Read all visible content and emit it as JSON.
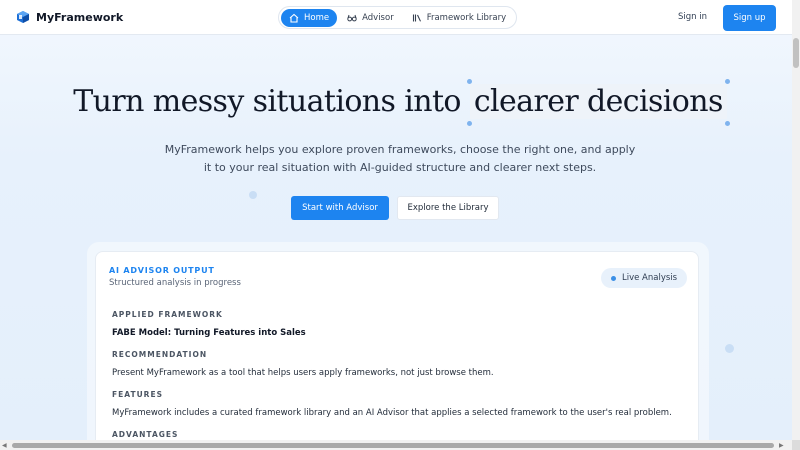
{
  "brand": {
    "name": "MyFramework",
    "logo_icon": "cube-logo-icon",
    "accent": "#1d84f0"
  },
  "nav": {
    "items": [
      {
        "label": "Home",
        "icon": "home-icon",
        "active": true
      },
      {
        "label": "Advisor",
        "icon": "glasses-icon",
        "active": false
      },
      {
        "label": "Framework Library",
        "icon": "library-icon",
        "active": false
      }
    ]
  },
  "auth": {
    "signin_label": "Sign in",
    "signup_label": "Sign up"
  },
  "hero": {
    "title_plain": "Turn messy situations into",
    "title_highlight": "clearer decisions",
    "subtitle_line1": "MyFramework helps you explore proven frameworks, choose the right one, and apply",
    "subtitle_line2": "it to your real situation with AI-guided structure and clearer next steps.",
    "primary_cta": "Start with Advisor",
    "secondary_cta": "Explore the Library"
  },
  "card": {
    "kicker": "AI ADVISOR OUTPUT",
    "status": "Structured analysis in progress",
    "badge": "Live Analysis",
    "sections": [
      {
        "label": "APPLIED FRAMEWORK",
        "value": "FABE Model: Turning Features into Sales",
        "bold": true
      },
      {
        "label": "RECOMMENDATION",
        "value": "Present MyFramework as a tool that helps users apply frameworks, not just browse them."
      },
      {
        "label": "FEATURES",
        "value": "MyFramework includes a curated framework library and an AI Advisor that applies a selected framework to the user's real problem."
      },
      {
        "label": "ADVANTAGES",
        "value": ""
      }
    ]
  }
}
